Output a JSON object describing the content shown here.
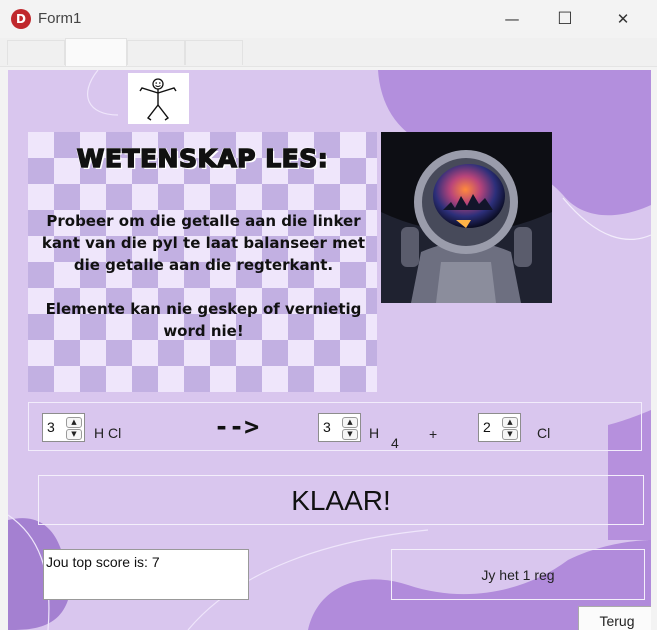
{
  "window": {
    "title": "Form1",
    "app_icon_letter": "D",
    "controls": {
      "minimize": "—",
      "maximize": "☐",
      "close": "✕"
    }
  },
  "tabs": [
    "",
    "",
    "",
    ""
  ],
  "lesson": {
    "title": "WETENSKAP LES:",
    "paragraph1": "Probeer om die getalle aan die linker kant van die pyl te laat balanseer met die getalle aan die regterkant.",
    "paragraph2": "Elemente kan nie geskep of vernietig word nie!"
  },
  "equation": {
    "left_coefficient": "3",
    "left_formula": "H Cl",
    "arrow": "-->",
    "right1_coefficient": "3",
    "right1_symbol": "H",
    "right1_subscript": "4",
    "plus": "+",
    "right2_coefficient": "2",
    "right2_symbol": "Cl"
  },
  "done_button": "KLAAR!",
  "top_score": "Jou top score is: 7",
  "result_text": "Jy het 1 reg",
  "back_button": "Terug",
  "icons": [
    "app-icon",
    "minimize-icon",
    "maximize-icon",
    "close-icon",
    "stick-figure-icon",
    "astronaut-image",
    "spin-up-icon",
    "spin-down-icon"
  ],
  "colors": {
    "background": "#d9c6ee",
    "accent_purple": "#b793dc",
    "titlebar": "#f3f3f3",
    "close_red": "#c0282d"
  }
}
